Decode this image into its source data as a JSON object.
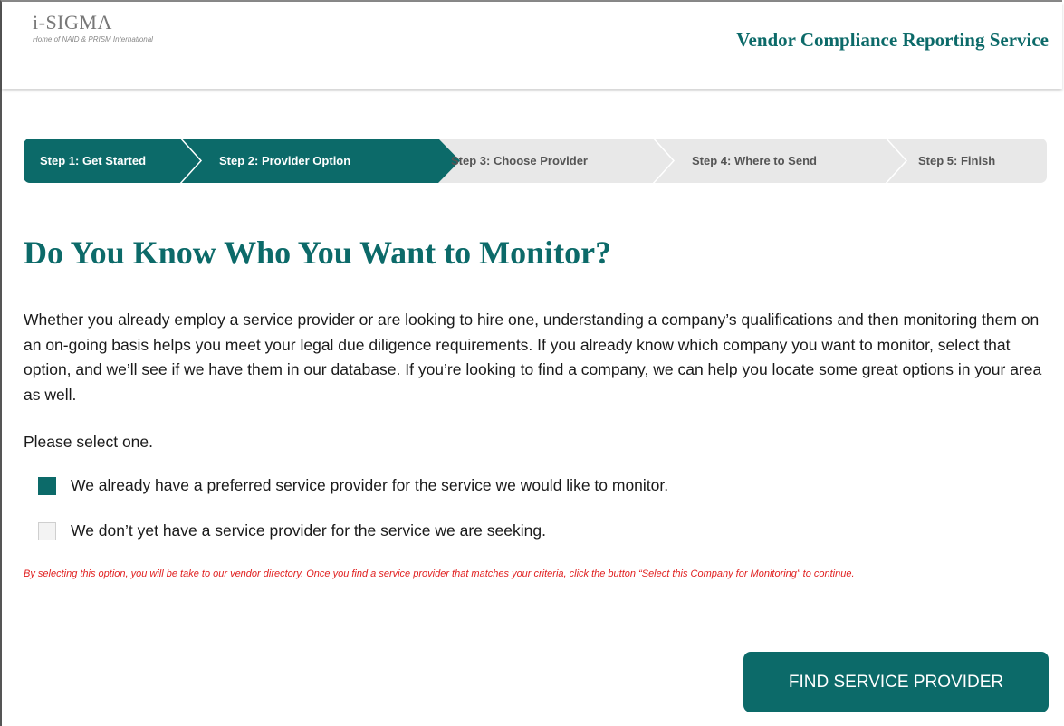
{
  "header": {
    "logo_text": "i-SIGMA",
    "logo_subtitle": "Home of NAID & PRISM International",
    "service_title": "Vendor Compliance Reporting Service"
  },
  "stepper": {
    "steps": [
      {
        "label": "Step 1: Get Started",
        "state": "completed"
      },
      {
        "label": "Step 2: Provider Option",
        "state": "current"
      },
      {
        "label": "Step 3: Choose Provider",
        "state": "upcoming"
      },
      {
        "label": "Step 4: Where to Send",
        "state": "upcoming"
      },
      {
        "label": "Step 5: Finish",
        "state": "upcoming"
      }
    ]
  },
  "main": {
    "heading": "Do You Know Who You Want to Monitor?",
    "intro": "Whether you already employ a service provider or are looking to hire one, understanding a company’s qualifications and then monitoring them on an on-going basis helps you meet your legal due diligence requirements. If you already know which company you want to monitor, select that option, and we’ll see if we have them in our database. If you’re looking to find a company, we can help you locate some great options in your area as well.",
    "prompt": "Please select one.",
    "options": [
      {
        "label": "We already have a preferred service provider for the service we would like to monitor.",
        "checked": true
      },
      {
        "label": "We don’t yet have a service provider for the service we are seeking.",
        "checked": false
      }
    ],
    "note": "By selecting this option, you will be take to our vendor directory. Once you find a service provider that matches your criteria, click the button “Select this Company for Monitoring” to continue.",
    "cta_label": "FIND SERVICE PROVIDER"
  },
  "colors": {
    "accent": "#0c6a69",
    "stepper_inactive": "#e8e8e8",
    "note": "#e01e1e"
  }
}
